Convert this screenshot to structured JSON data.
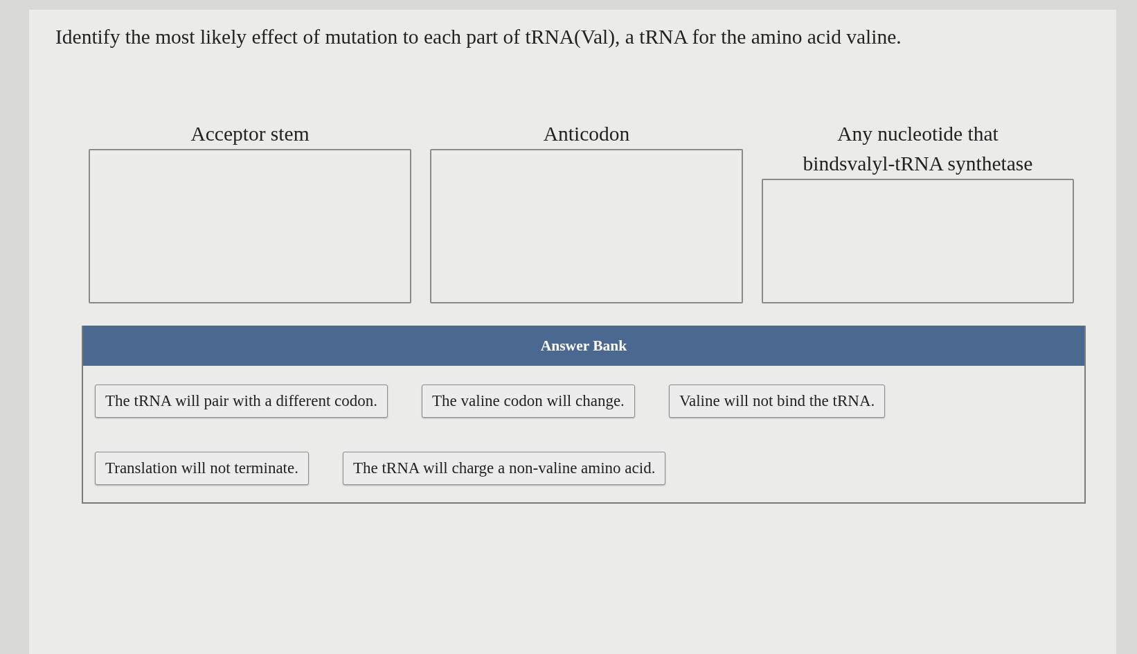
{
  "question": "Identify the most likely effect of mutation to each part of tRNA(Val), a tRNA for the amino acid valine.",
  "drop_zones": [
    {
      "label": "Acceptor stem"
    },
    {
      "label": "Anticodon"
    },
    {
      "label": "Any nucleotide that bindsvalyl-tRNA synthetase"
    }
  ],
  "answer_bank": {
    "title": "Answer Bank",
    "answers": [
      "The tRNA will pair with a different codon.",
      "The valine codon will change.",
      "Valine will not bind the tRNA.",
      "Translation will not terminate.",
      "The tRNA will charge a non-valine amino acid."
    ]
  }
}
